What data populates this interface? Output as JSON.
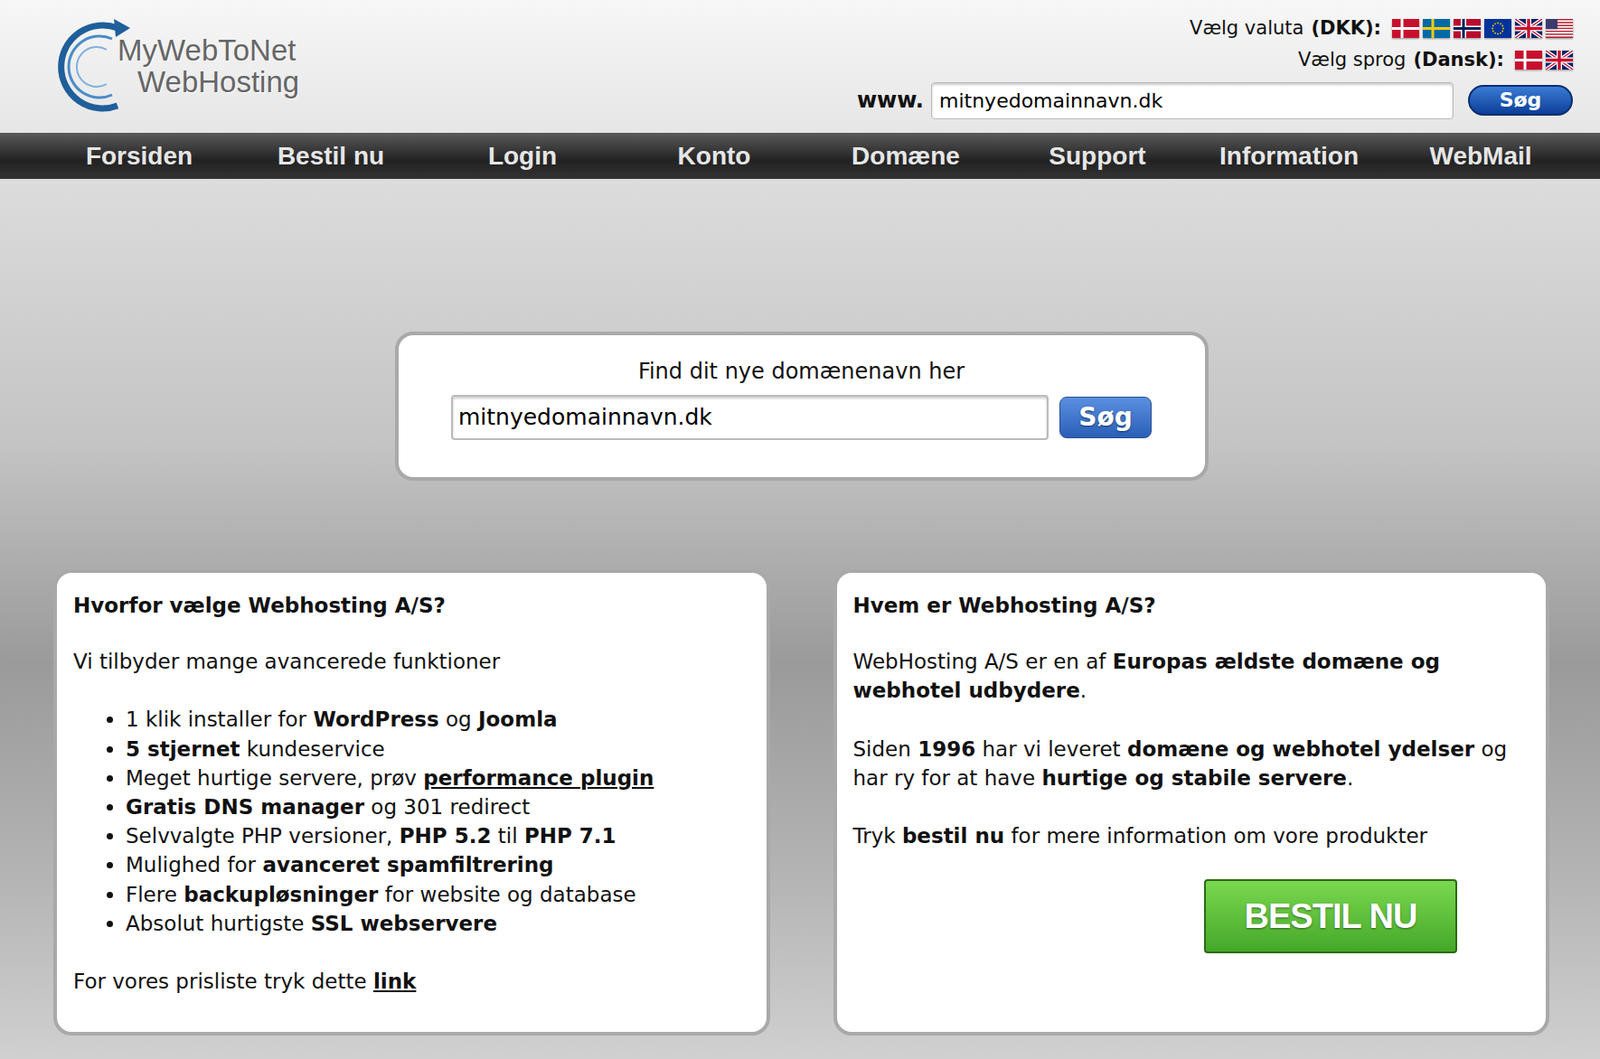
{
  "logo": {
    "line1": "MyWebToNet",
    "line2": "WebHosting"
  },
  "currency": {
    "label": "Vælg valuta",
    "value": "(DKK):",
    "flags": [
      {
        "kind": "denmark"
      },
      {
        "kind": "sweden"
      },
      {
        "kind": "norway"
      },
      {
        "kind": "eu"
      },
      {
        "kind": "uk"
      },
      {
        "kind": "usa"
      }
    ]
  },
  "language": {
    "label": "Vælg sprog",
    "value": "(Dansk):",
    "flags": [
      {
        "kind": "denmark"
      },
      {
        "kind": "uk"
      }
    ]
  },
  "top_search": {
    "prefix": "www.",
    "value": "mitnyedomainnavn.dk",
    "button": "Søg"
  },
  "nav": [
    "Forsiden",
    "Bestil nu",
    "Login",
    "Konto",
    "Domæne",
    "Support",
    "Information",
    "WebMail"
  ],
  "hero_search": {
    "title": "Find dit nye domænenavn her",
    "value": "mitnyedomainnavn.dk",
    "button": "Søg"
  },
  "why": {
    "title": "Hvorfor vælge Webhosting A/S?",
    "intro": "Vi tilbyder mange avancerede funktioner",
    "features": [
      {
        "segments": [
          {
            "kind": "plain",
            "text": "1 klik installer for "
          },
          {
            "kind": "bold",
            "text": "WordPress"
          },
          {
            "kind": "plain",
            "text": " og "
          },
          {
            "kind": "bold",
            "text": "Joomla"
          }
        ]
      },
      {
        "segments": [
          {
            "kind": "bold",
            "text": "5 stjernet"
          },
          {
            "kind": "plain",
            "text": " kundeservice"
          }
        ]
      },
      {
        "segments": [
          {
            "kind": "plain",
            "text": "Meget hurtige servere, prøv "
          },
          {
            "kind": "link",
            "text": "performance plugin"
          }
        ]
      },
      {
        "segments": [
          {
            "kind": "bold",
            "text": "Gratis DNS manager"
          },
          {
            "kind": "plain",
            "text": " og 301 redirect"
          }
        ]
      },
      {
        "segments": [
          {
            "kind": "plain",
            "text": "Selvvalgte PHP versioner, "
          },
          {
            "kind": "bold",
            "text": "PHP 5.2"
          },
          {
            "kind": "plain",
            "text": " til "
          },
          {
            "kind": "bold",
            "text": "PHP 7.1"
          }
        ]
      },
      {
        "segments": [
          {
            "kind": "plain",
            "text": "Mulighed for "
          },
          {
            "kind": "bold",
            "text": "avanceret spamfiltrering"
          }
        ]
      },
      {
        "segments": [
          {
            "kind": "plain",
            "text": "Flere "
          },
          {
            "kind": "bold",
            "text": "backupløsninger"
          },
          {
            "kind": "plain",
            "text": " for website og database"
          }
        ]
      },
      {
        "segments": [
          {
            "kind": "plain",
            "text": "Absolut hurtigste "
          },
          {
            "kind": "bold",
            "text": "SSL webservere"
          }
        ]
      }
    ],
    "footer": {
      "segments": [
        {
          "kind": "plain",
          "text": "For vores prisliste tryk dette "
        },
        {
          "kind": "link",
          "text": "link"
        }
      ]
    }
  },
  "who": {
    "title": "Hvem er Webhosting A/S?",
    "paragraphs": [
      {
        "segments": [
          {
            "kind": "plain",
            "text": "WebHosting A/S er en af "
          },
          {
            "kind": "bold",
            "text": "Europas ældste domæne og webhotel udbydere"
          },
          {
            "kind": "plain",
            "text": "."
          }
        ]
      },
      {
        "segments": [
          {
            "kind": "plain",
            "text": "Siden "
          },
          {
            "kind": "bold",
            "text": "1996"
          },
          {
            "kind": "plain",
            "text": " har vi leveret "
          },
          {
            "kind": "bold",
            "text": "domæne og webhotel ydelser"
          },
          {
            "kind": "plain",
            "text": " og har ry for at have "
          },
          {
            "kind": "bold",
            "text": "hurtige og stabile servere"
          },
          {
            "kind": "plain",
            "text": "."
          }
        ]
      },
      {
        "segments": [
          {
            "kind": "plain",
            "text": "Tryk "
          },
          {
            "kind": "bold",
            "text": "bestil nu"
          },
          {
            "kind": "plain",
            "text": " for mere information om vore produkter"
          }
        ]
      }
    ],
    "button": "BESTIL NU"
  }
}
